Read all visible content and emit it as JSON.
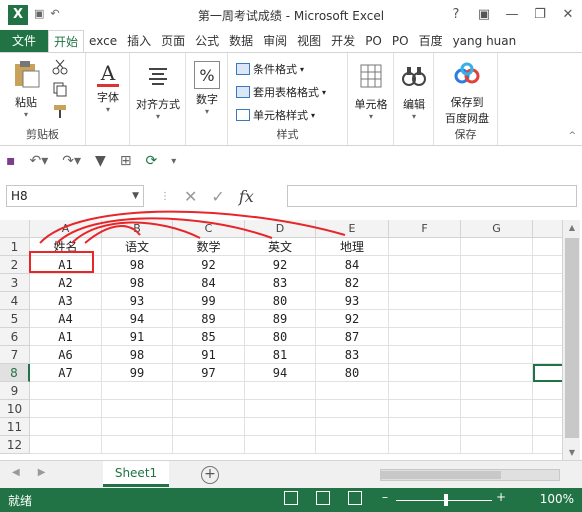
{
  "app": {
    "title": "第一周考试成绩 - Microsoft Excel",
    "logo_letter": "X"
  },
  "window_buttons": [
    "?",
    "▣",
    "—",
    "❐",
    "✕"
  ],
  "tabs": [
    {
      "label": "文件",
      "kind": "file"
    },
    {
      "label": "开始",
      "kind": "active"
    },
    {
      "label": "exce",
      "kind": "normal"
    },
    {
      "label": "插入",
      "kind": "normal"
    },
    {
      "label": "页面",
      "kind": "normal"
    },
    {
      "label": "公式",
      "kind": "normal"
    },
    {
      "label": "数据",
      "kind": "normal"
    },
    {
      "label": "审阅",
      "kind": "normal"
    },
    {
      "label": "视图",
      "kind": "normal"
    },
    {
      "label": "开发",
      "kind": "normal"
    },
    {
      "label": "PO",
      "kind": "normal"
    },
    {
      "label": "PO",
      "kind": "normal"
    },
    {
      "label": "百度",
      "kind": "normal"
    },
    {
      "label": "yang huan",
      "kind": "normal"
    }
  ],
  "ribbon": {
    "clipboard": {
      "paste": "粘贴",
      "group": "剪贴板"
    },
    "font": {
      "label": "字体",
      "icon_letter": "A"
    },
    "alignment": {
      "label": "对齐方式"
    },
    "number": {
      "label": "数字",
      "icon_text": "%"
    },
    "styles": {
      "conditional": "条件格式",
      "table_format": "套用表格格式",
      "cell_style": "单元格样式",
      "group": "样式"
    },
    "cells": {
      "label": "单元格"
    },
    "editing": {
      "label": "编辑"
    },
    "save": {
      "label1": "保存到",
      "label2": "百度网盘",
      "group": "保存"
    }
  },
  "formula_bar": {
    "name_box": "H8",
    "fx": "fx",
    "content": ""
  },
  "columns": [
    "A",
    "B",
    "C",
    "D",
    "E",
    "F",
    "G"
  ],
  "rows": [
    "1",
    "2",
    "3",
    "4",
    "5",
    "6",
    "7",
    "8",
    "9",
    "10",
    "11",
    "12"
  ],
  "table": [
    [
      "姓名",
      "语文",
      "数学",
      "英文",
      "地理",
      "",
      ""
    ],
    [
      "A1",
      "98",
      "92",
      "92",
      "84",
      "",
      ""
    ],
    [
      "A2",
      "98",
      "84",
      "83",
      "82",
      "",
      ""
    ],
    [
      "A3",
      "93",
      "99",
      "80",
      "93",
      "",
      ""
    ],
    [
      "A4",
      "94",
      "89",
      "89",
      "92",
      "",
      ""
    ],
    [
      "A1",
      "91",
      "85",
      "80",
      "87",
      "",
      ""
    ],
    [
      "A6",
      "98",
      "91",
      "81",
      "83",
      "",
      ""
    ],
    [
      "A7",
      "99",
      "97",
      "94",
      "80",
      "",
      ""
    ],
    [
      "",
      "",
      "",
      "",
      "",
      "",
      ""
    ],
    [
      "",
      "",
      "",
      "",
      "",
      "",
      ""
    ],
    [
      "",
      "",
      "",
      "",
      "",
      "",
      ""
    ],
    [
      "",
      "",
      "",
      "",
      "",
      "",
      ""
    ]
  ],
  "selected_row": "8",
  "selected_cell": "H8",
  "sheet_tab": "Sheet1",
  "status": {
    "ready": "就绪",
    "zoom": "100%"
  },
  "colors": {
    "brand": "#217346",
    "annotation": "#e8262a"
  }
}
